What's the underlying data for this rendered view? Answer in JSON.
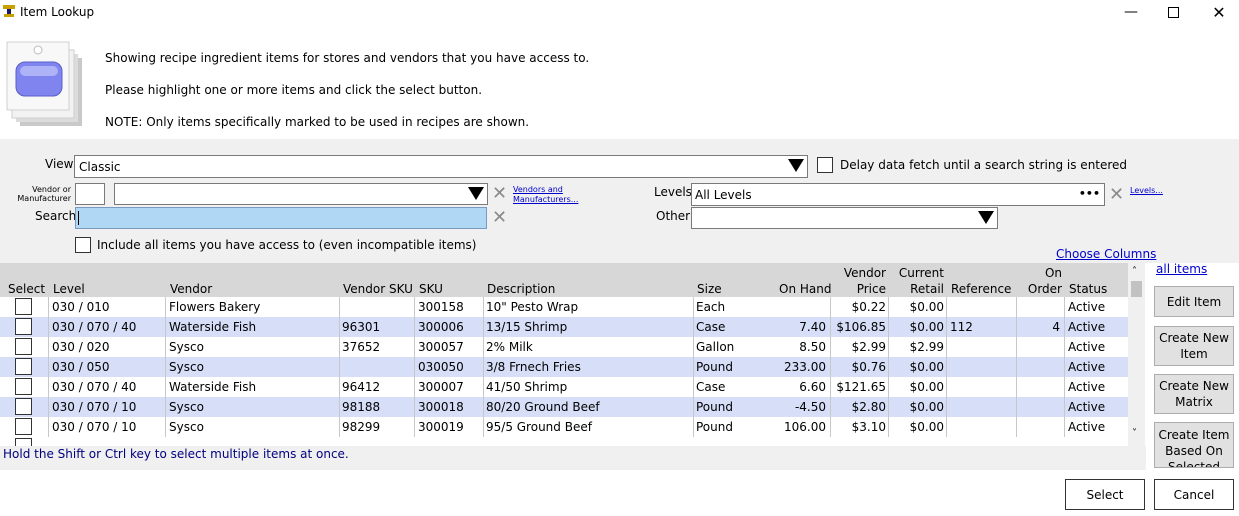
{
  "window": {
    "title": "Item Lookup"
  },
  "header": {
    "line1": "Showing recipe ingredient items for stores and vendors that you have access to.",
    "line2": "Please highlight one or more items and click the select button.",
    "line3": "NOTE: Only items specifically marked to be used in recipes are shown."
  },
  "filters": {
    "view_label": "View",
    "view_value": "Classic",
    "delay_label": "Delay data fetch until a search string is entered",
    "vendor_label_1": "Vendor or",
    "vendor_label_2": "Manufacturer",
    "vendor_code": "",
    "vendor_value": "",
    "vendors_link_1": "Vendors and",
    "vendors_link_2": "Manufacturers...",
    "levels_label": "Levels",
    "levels_value": "All Levels",
    "levels_ellipsis": "•••",
    "levels_link": "Levels...",
    "search_label": "Search",
    "search_value": "",
    "other_label": "Other",
    "other_value": "",
    "include_label": "Include all items you have access to (even incompatible items)",
    "choose_columns": "Choose Columns",
    "all_items": "all items"
  },
  "grid": {
    "headers": {
      "select": "Select",
      "level": "Level",
      "vendor": "Vendor",
      "vendor_sku": "Vendor SKU",
      "sku": "SKU",
      "description": "Description",
      "size": "Size",
      "on_hand": "On Hand",
      "vendor_price_1": "Vendor",
      "vendor_price_2": "Price",
      "current_retail_1": "Current",
      "current_retail_2": "Retail",
      "reference": "Reference",
      "on_order_1": "On",
      "on_order_2": "Order",
      "status": "Status"
    },
    "rows": [
      {
        "level": "030 / 010",
        "vendor": "Flowers Bakery",
        "vendor_sku": "",
        "sku": "300158",
        "description": "10\" Pesto Wrap",
        "size": "Each",
        "on_hand": "",
        "vendor_price": "$0.22",
        "current_retail": "$0.00",
        "reference": "",
        "on_order": "",
        "status": "Active"
      },
      {
        "level": "030 / 070 / 40",
        "vendor": "Waterside Fish",
        "vendor_sku": "96301",
        "sku": "300006",
        "description": "13/15 Shrimp",
        "size": "Case",
        "on_hand": "7.40",
        "vendor_price": "$106.85",
        "current_retail": "$0.00",
        "reference": "112",
        "on_order": "4",
        "status": "Active"
      },
      {
        "level": "030 / 020",
        "vendor": "Sysco",
        "vendor_sku": "37652",
        "sku": "300057",
        "description": "2% Milk",
        "size": "Gallon",
        "on_hand": "8.50",
        "vendor_price": "$2.99",
        "current_retail": "$2.99",
        "reference": "",
        "on_order": "",
        "status": "Active"
      },
      {
        "level": "030 / 050",
        "vendor": "Sysco",
        "vendor_sku": "",
        "sku": "030050",
        "description": "3/8 Frnech Fries",
        "size": "Pound",
        "on_hand": "233.00",
        "vendor_price": "$0.76",
        "current_retail": "$0.00",
        "reference": "",
        "on_order": "",
        "status": "Active"
      },
      {
        "level": "030 / 070 / 40",
        "vendor": "Waterside Fish",
        "vendor_sku": "96412",
        "sku": "300007",
        "description": "41/50 Shrimp",
        "size": "Case",
        "on_hand": "6.60",
        "vendor_price": "$121.65",
        "current_retail": "$0.00",
        "reference": "",
        "on_order": "",
        "status": "Active"
      },
      {
        "level": "030 / 070 / 10",
        "vendor": "Sysco",
        "vendor_sku": "98188",
        "sku": "300018",
        "description": "80/20 Ground Beef",
        "size": "Pound",
        "on_hand": "-4.50",
        "vendor_price": "$2.80",
        "current_retail": "$0.00",
        "reference": "",
        "on_order": "",
        "status": "Active"
      },
      {
        "level": "030 / 070 / 10",
        "vendor": "Sysco",
        "vendor_sku": "98299",
        "sku": "300019",
        "description": "95/5 Ground Beef",
        "size": "Pound",
        "on_hand": "106.00",
        "vendor_price": "$3.10",
        "current_retail": "$0.00",
        "reference": "",
        "on_order": "",
        "status": "Active"
      }
    ]
  },
  "side_buttons": {
    "edit_item": "Edit Item",
    "create_new_item_1": "Create New",
    "create_new_item_2": "Item",
    "create_new_matrix_1": "Create New",
    "create_new_matrix_2": "Matrix",
    "create_based_1": "Create Item",
    "create_based_2": "Based On",
    "create_based_3": "Selected"
  },
  "footer": {
    "hint": "Hold the Shift or Ctrl key to select multiple items at once.",
    "select": "Select",
    "cancel": "Cancel"
  }
}
